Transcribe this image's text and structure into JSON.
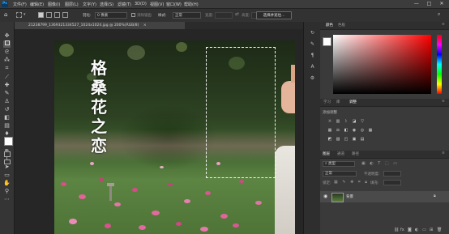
{
  "app": {
    "logo": "Ps"
  },
  "menu": [
    "文件(F)",
    "编辑(E)",
    "图像(I)",
    "图层(L)",
    "文字(Y)",
    "选择(S)",
    "滤镜(T)",
    "3D(D)",
    "视图(V)",
    "窗口(W)",
    "帮助(H)"
  ],
  "window_controls": {
    "minimize": "—",
    "maximize": "□",
    "close": "✕"
  },
  "options": {
    "feather_label": "羽化:",
    "feather_value": "0 像素",
    "antialias_label": "消除锯齿",
    "style_label": "样式:",
    "style_value": "正常",
    "width_label": "宽度:",
    "height_label": "高度:",
    "select_mask_button": "选择并遮住..."
  },
  "document": {
    "tab_title": "21238799_1369321334527_1024x1024.jpg @ 200%(RGB/8)",
    "tab_close": "×",
    "overlay_text": [
      "格",
      "桑",
      "花",
      "之",
      "恋"
    ]
  },
  "colors": {
    "foreground": "#ffffff",
    "background": "#000000",
    "accent": "#ff0000"
  },
  "panels": {
    "color_tabs": [
      "颜色",
      "色板"
    ],
    "adjust_tabs": [
      "学习",
      "库",
      "调整"
    ],
    "adjust_title": "添加调整",
    "layer_tabs": [
      "图层",
      "通道",
      "路径"
    ],
    "layer_kind": "类型",
    "blend_mode": "正常",
    "opacity_label": "不透明度:",
    "lock_label": "锁定:",
    "fill_label": "填充:",
    "layer_name": "背景"
  },
  "tools": [
    "move-icon",
    "marquee-icon",
    "lasso-icon",
    "magic-wand-icon",
    "crop-icon",
    "eyedropper-icon",
    "healing-icon",
    "brush-icon",
    "stamp-icon",
    "history-brush-icon",
    "eraser-icon",
    "gradient-icon",
    "blur-icon",
    "dodge-icon",
    "pen-icon",
    "type-icon",
    "path-select-icon",
    "shape-icon",
    "hand-icon",
    "zoom-icon",
    "more-icon"
  ]
}
